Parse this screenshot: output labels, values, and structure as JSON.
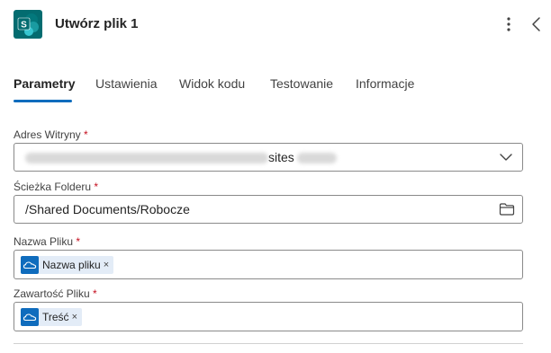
{
  "header": {
    "title": "Utwórz plik 1",
    "app_icon": "sharepoint-icon",
    "more_icon": "more-vertical-icon",
    "collapse_icon": "chevron-left-icon"
  },
  "tabs": [
    {
      "label": "Parametry",
      "active": true
    },
    {
      "label": "Ustawienia",
      "active": false
    },
    {
      "label": "Widok kodu",
      "active": false
    },
    {
      "label": "Testowanie",
      "active": false
    },
    {
      "label": "Informacje",
      "active": false
    }
  ],
  "fields": {
    "site_address": {
      "label": "Adres Witryny",
      "required_mark": "*",
      "visible_value": "sites"
    },
    "folder_path": {
      "label": "Ścieżka Folderu",
      "required_mark": "*",
      "value": "/Shared Documents/Robocze"
    },
    "file_name": {
      "label": "Nazwa Pliku",
      "required_mark": "*",
      "token": "Nazwa pliku",
      "token_remove": "×"
    },
    "file_content": {
      "label": "Zawartość Pliku",
      "required_mark": "*",
      "token": "Treść",
      "token_remove": "×"
    }
  },
  "colors": {
    "accent": "#0f6cbd",
    "sharepoint": "#036c70",
    "required": "#c50f1f",
    "token_bg": "#e3ecf7"
  }
}
